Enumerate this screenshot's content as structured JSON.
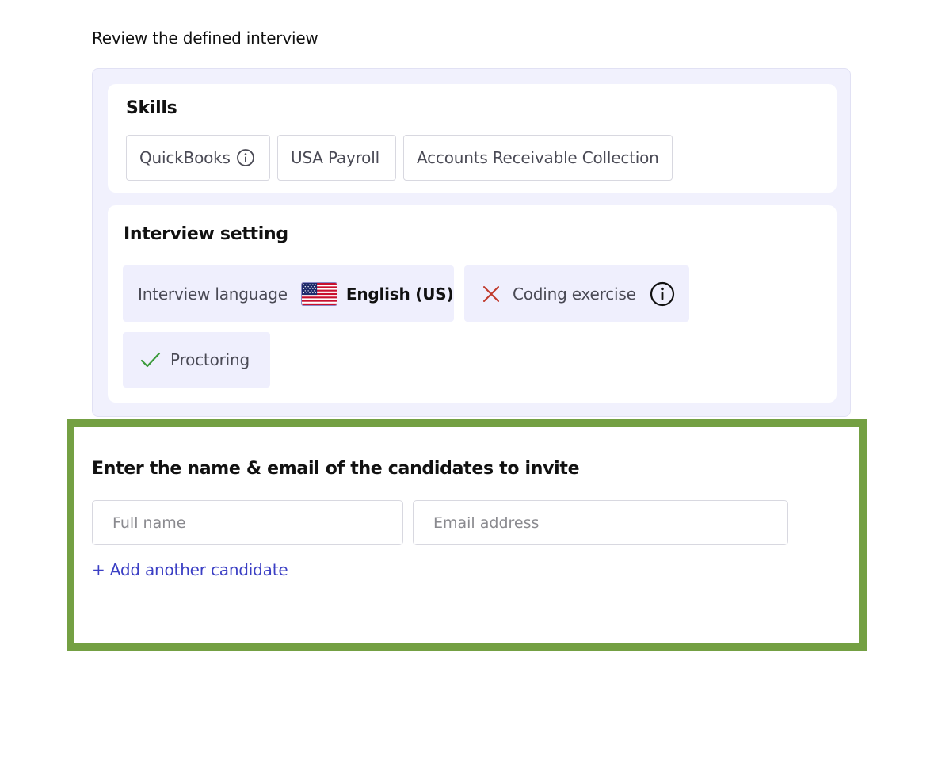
{
  "review": {
    "heading": "Review the defined interview"
  },
  "skills": {
    "title": "Skills",
    "items": [
      {
        "label": "QuickBooks",
        "has_info": true
      },
      {
        "label": "USA Payroll",
        "has_info": false
      },
      {
        "label": "Accounts Receivable Collection",
        "has_info": false
      }
    ]
  },
  "settings": {
    "title": "Interview setting",
    "language": {
      "label": "Interview language",
      "value": "English (US)",
      "flag_icon": "us-flag-icon"
    },
    "coding": {
      "label": "Coding exercise",
      "status_icon": "x-icon",
      "status_color": "#c0392b",
      "info_icon": "info-icon"
    },
    "proctoring": {
      "label": "Proctoring",
      "status_icon": "check-icon",
      "status_color": "#3a9a3a"
    }
  },
  "invite": {
    "title": "Enter the name & email of the candidates to invite",
    "name_placeholder": "Full name",
    "name_value": "",
    "email_placeholder": "Email address",
    "email_value": "",
    "add_label": "+ Add another candidate"
  },
  "colors": {
    "panel_bg": "#f1f1fd",
    "chip_bg": "#efeffd",
    "link": "#3b3fc4",
    "highlight_frame": "#74a043"
  }
}
